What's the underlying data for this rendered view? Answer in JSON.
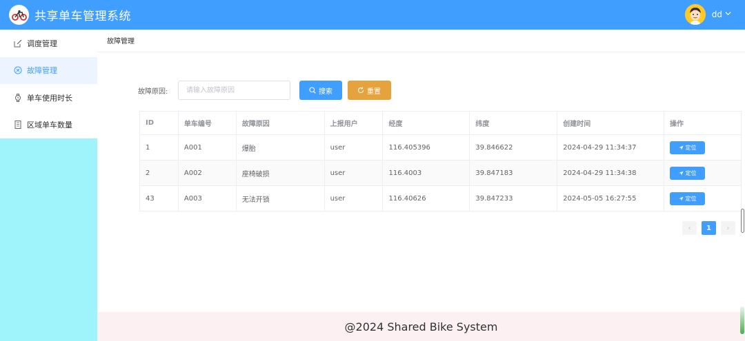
{
  "app": {
    "title": "共享单车管理系统"
  },
  "user": {
    "name": "dd"
  },
  "sidebar": {
    "items": [
      {
        "label": "调度管理",
        "icon": "edit-icon"
      },
      {
        "label": "故障管理",
        "icon": "circle-close-icon",
        "active": true
      },
      {
        "label": "单车使用时长",
        "icon": "watch-icon"
      },
      {
        "label": "区域单车数量",
        "icon": "document-icon"
      }
    ]
  },
  "breadcrumb": "故障管理",
  "search": {
    "label": "故障原因:",
    "placeholder": "请输入故障原因",
    "value": "",
    "search_button": "搜索",
    "reset_button": "重置"
  },
  "table": {
    "headers": [
      "ID",
      "单车编号",
      "故障原因",
      "上报用户",
      "经度",
      "纬度",
      "创建时间",
      "操作"
    ],
    "rows": [
      {
        "id": "1",
        "bike_no": "A001",
        "reason": "爆胎",
        "user": "user",
        "lng": "116.405396",
        "lat": "39.846622",
        "created": "2024-04-29 11:34:37",
        "action": "定位"
      },
      {
        "id": "2",
        "bike_no": "A002",
        "reason": "座椅破损",
        "user": "user",
        "lng": "116.4003",
        "lat": "39.847183",
        "created": "2024-04-29 11:34:38",
        "action": "定位"
      },
      {
        "id": "43",
        "bike_no": "A003",
        "reason": "无法开锁",
        "user": "user",
        "lng": "116.40626",
        "lat": "39.847233",
        "created": "2024-05-05 16:27:55",
        "action": "定位"
      }
    ]
  },
  "pagination": {
    "prev": "‹",
    "current": "1",
    "next": "›"
  },
  "footer": "@2024 Shared Bike System",
  "colors": {
    "primary": "#409eff",
    "warning": "#e6a23c",
    "sidebar_bg": "#9ff4fb",
    "footer_bg": "#fdf0f3"
  }
}
